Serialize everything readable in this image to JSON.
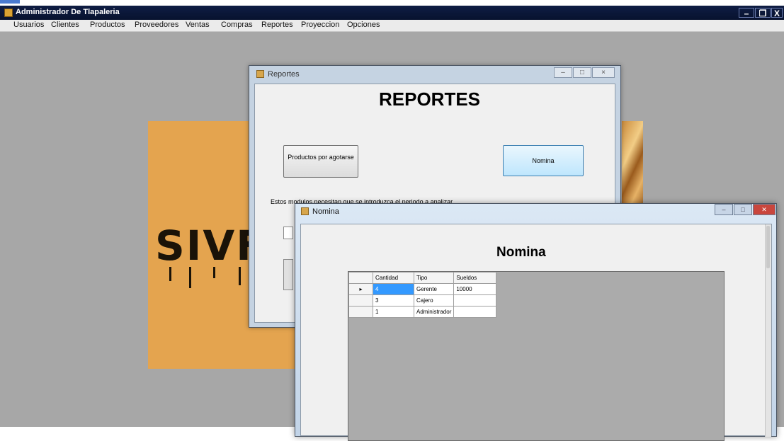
{
  "main_window": {
    "title": "Administrador De Tlapaleria",
    "controls": {
      "minimize": "–",
      "maximize": "❐",
      "close": "X"
    }
  },
  "menu": [
    "Usuarios",
    "Clientes",
    "Productos",
    "Proveedores",
    "Ventas",
    "Compras",
    "Reportes",
    "Proyeccion",
    "Opciones"
  ],
  "background_logo": {
    "text": "SIVF"
  },
  "reportes_window": {
    "title": "Reportes",
    "heading": "REPORTES",
    "btn_productos": "Productos por agotarse",
    "btn_nomina": "Nomina",
    "note": "Estos modulos necesitan que se introduzca el periodo a analizar"
  },
  "nomina_window": {
    "title": "Nomina",
    "heading": "Nomina",
    "grid": {
      "columns": [
        "Cantidad",
        "Tipo",
        "Sueldos"
      ],
      "rows": [
        {
          "cantidad": "4",
          "tipo": "Gerente",
          "sueldos": "10000",
          "current": "▸"
        },
        {
          "cantidad": "3",
          "tipo": "Cajero",
          "sueldos": "",
          "current": ""
        },
        {
          "cantidad": "1",
          "tipo": "Administrador",
          "sueldos": "",
          "current": ""
        }
      ]
    }
  },
  "colors": {
    "mdi_background": "#a7a7a7",
    "logo_background": "#e4a44f",
    "selection": "#3399ff",
    "close_button": "#c9463d"
  }
}
